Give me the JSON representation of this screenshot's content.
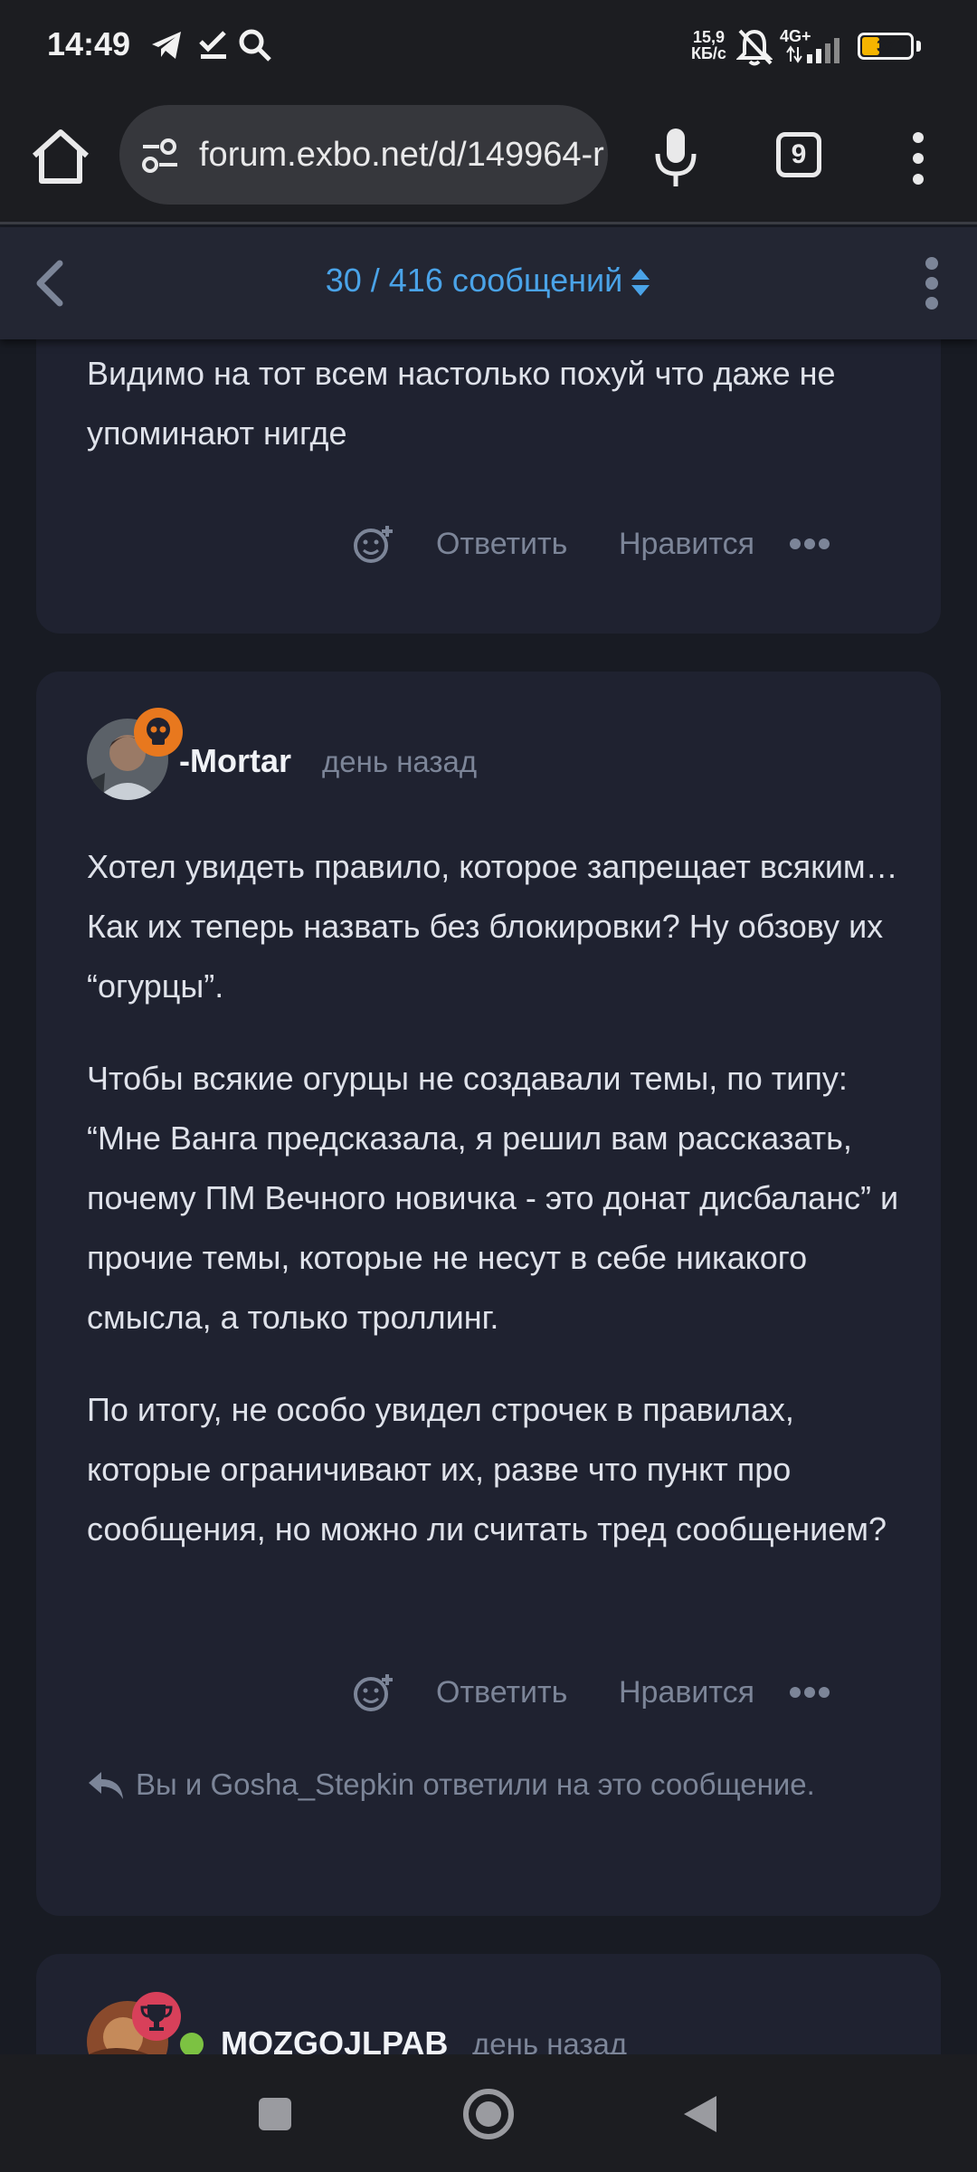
{
  "status_bar": {
    "time": "14:49",
    "net_speed_value": "15,9",
    "net_speed_unit": "КБ/с",
    "network": "4G+",
    "battery_level": "37",
    "icons": [
      "telegram-icon",
      "check-icon",
      "search-icon",
      "mute-bell-icon",
      "signal-icon"
    ]
  },
  "browser": {
    "url": "forum.exbo.net/d/149964-r",
    "tab_count": "9"
  },
  "forum_header": {
    "position": "30 / 416 сообщений"
  },
  "posts": [
    {
      "body": [
        "Видимо на тот всем настолько похуй что даже не упоминают нигде"
      ],
      "actions": {
        "react": "add-reaction-icon",
        "reply": "Ответить",
        "like": "Нравится"
      }
    },
    {
      "author": "-Mortar",
      "time": "день назад",
      "badge": "skull-icon",
      "body": [
        "Хотел увидеть правило, которое запрещает всяким… Как их теперь назвать без блокировки? Ну обзову их “огурцы”.",
        "Чтобы всякие огурцы не создавали темы, по типу: “Мне Ванга предсказала, я решил вам рассказать, почему ПМ Вечного новичка - это донат дисбаланс” и прочие темы, которые не несут в себе никакого смысла, а только троллинг.",
        "По итогу, не особо увидел строчек в правилах, которые ограничивают их, разве что пункт про сообщения, но можно ли считать тред сообщением?"
      ],
      "actions": {
        "react": "add-reaction-icon",
        "reply": "Ответить",
        "like": "Нравится"
      },
      "replied_by": "Вы и Gosha_Stepkin ответили на это сообщение."
    },
    {
      "author": "MOZGOJLPAB",
      "time": "день назад",
      "badge": "trophy-icon",
      "online": true
    }
  ],
  "colors": {
    "background": "#181b23",
    "card": "#1f2230",
    "accent": "#4aa3e8",
    "muted": "#7c8598",
    "skull_badge": "#e8781e",
    "trophy_badge": "#d8405a",
    "online": "#7cc242"
  }
}
